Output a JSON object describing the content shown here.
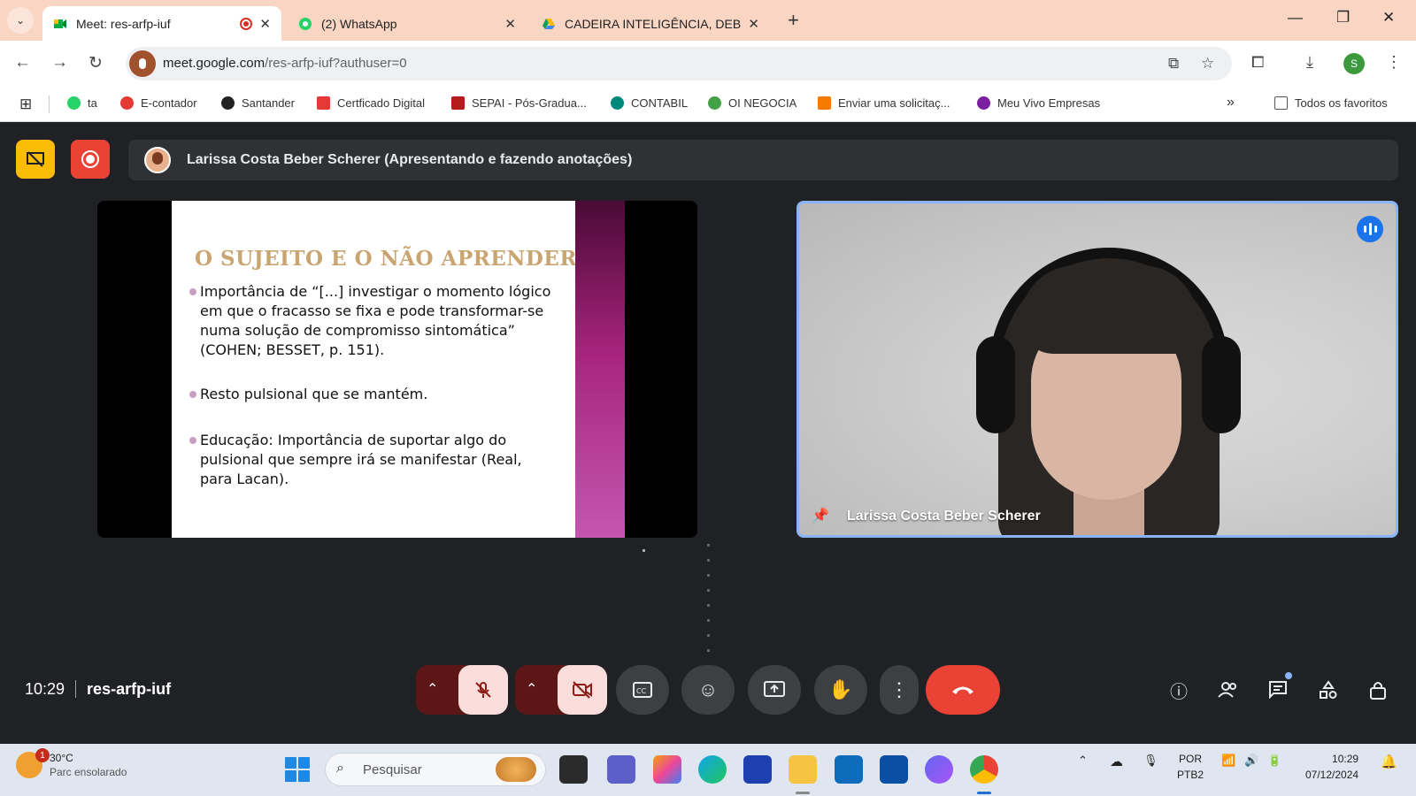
{
  "browser": {
    "tabs": [
      {
        "title": "Meet: res-arfp-iuf",
        "active": true,
        "recording": true
      },
      {
        "title": "(2) WhatsApp",
        "active": false
      },
      {
        "title": "CADEIRA INTELIGÊNCIA, DEBIL",
        "active": false
      }
    ],
    "new_tab": "+",
    "url_host": "meet.google.com",
    "url_path": "/res-arfp-iuf?authuser=0",
    "profile_initial": "S",
    "bookmarks": [
      {
        "label": "ta",
        "color": "#25d366"
      },
      {
        "label": "E-contador",
        "color": "#e53935"
      },
      {
        "label": "Santander",
        "color": "#222222"
      },
      {
        "label": "Certficado Digital",
        "color": "#e53935"
      },
      {
        "label": "SEPAI - Pós-Gradua...",
        "color": "#b71c1c"
      },
      {
        "label": "CONTABIL",
        "color": "#00897b"
      },
      {
        "label": "OI NEGOCIA",
        "color": "#43a047"
      },
      {
        "label": "Enviar uma solicitaç...",
        "color": "#f57c00"
      },
      {
        "label": "Meu Vivo Empresas",
        "color": "#7b1fa2"
      }
    ],
    "more_bookmarks": "»",
    "all_bookmarks": "Todos os favoritos"
  },
  "meet": {
    "presenter_banner": "Larissa Costa Beber Scherer (Apresentando e fazendo anotações)",
    "slide": {
      "title": "O SUJEITO E O NÃO APRENDER",
      "bullets": [
        "Importância de “[...] investigar o momento lógico em que o fracasso se fixa e pode transformar-se numa solução de compromisso sintomática” (COHEN; BESSET, p. 151).",
        "Resto pulsional que se mantém.",
        "Educação: Importância de suportar algo do pulsional que sempre irá se manifestar (Real, para Lacan)."
      ]
    },
    "participant_name": "Larissa Costa Beber Scherer",
    "time": "10:29",
    "meeting_code": "res-arfp-iuf",
    "accent": "#8ab4f8",
    "hangup_color": "#ea4335"
  },
  "taskbar": {
    "temperature": "30°C",
    "weather": "Parc ensolarado",
    "weather_badge": "1",
    "search_placeholder": "Pesquisar",
    "lang_top": "POR",
    "lang_bottom": "PTB2",
    "clock_time": "10:29",
    "clock_date": "07/12/2024"
  }
}
